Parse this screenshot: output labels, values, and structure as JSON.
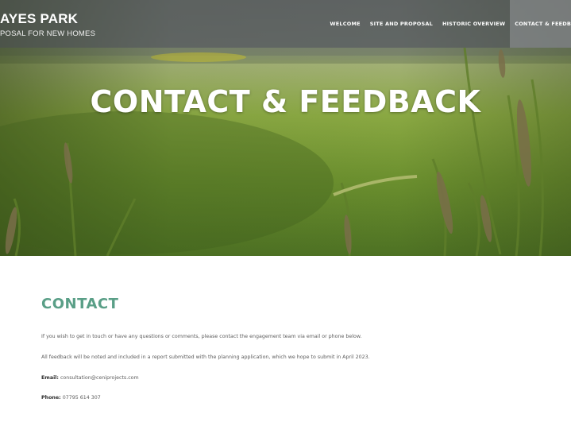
{
  "header": {
    "brand_title": "AYES PARK",
    "brand_subtitle": "POSAL FOR NEW HOMES",
    "nav": [
      {
        "label": "WELCOME"
      },
      {
        "label": "SITE AND PROPOSAL"
      },
      {
        "label": "HISTORIC OVERVIEW"
      },
      {
        "label": "CONTACT & FEEDB"
      }
    ]
  },
  "hero": {
    "title": "CONTACT & FEEDBACK"
  },
  "main": {
    "section_title": "CONTACT",
    "paragraph1": "If you wish to get in touch or have any questions or comments, please contact the engagement team via email or phone below.",
    "paragraph2": "All feedback will be noted and included in a report submitted with the planning application, which we hope to submit in April 2023.",
    "email_label": "Email:",
    "email_value": "consultation@ceniprojects.com",
    "phone_label": "Phone:",
    "phone_value": "07795 614 307"
  },
  "colors": {
    "accent": "#5a9f87",
    "nav_bar": "#46484a",
    "grass": "#7a9a3c"
  }
}
